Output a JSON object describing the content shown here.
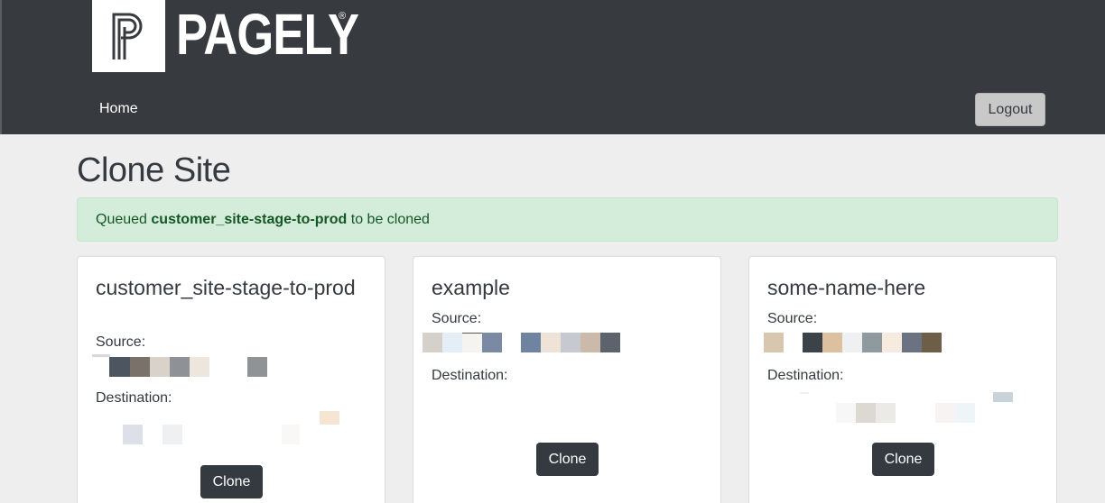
{
  "header": {
    "brand": "PAGELY",
    "registered_mark": "®",
    "nav_home": "Home",
    "logout_label": "Logout"
  },
  "page": {
    "title": "Clone Site"
  },
  "alert": {
    "prefix": "Queued",
    "site": "customer_site-stage-to-prod",
    "suffix": "to be cloned"
  },
  "cards": [
    {
      "name": "customer_site-stage-to-prod",
      "source_label": "Source:",
      "destination_label": "Destination:",
      "clone_label": "Clone"
    },
    {
      "name": "example",
      "source_label": "Source:",
      "destination_label": "Destination:",
      "clone_label": "Clone"
    },
    {
      "name": "some-name-here",
      "source_label": "Source:",
      "destination_label": "Destination:",
      "clone_label": "Clone"
    }
  ],
  "colors": {
    "header_bg": "#373b3f",
    "page_bg": "#eeeeee",
    "alert_bg": "#d4edda",
    "alert_text": "#155724",
    "button_dark": "#343a40",
    "logout_bg": "#c8c8c8"
  }
}
